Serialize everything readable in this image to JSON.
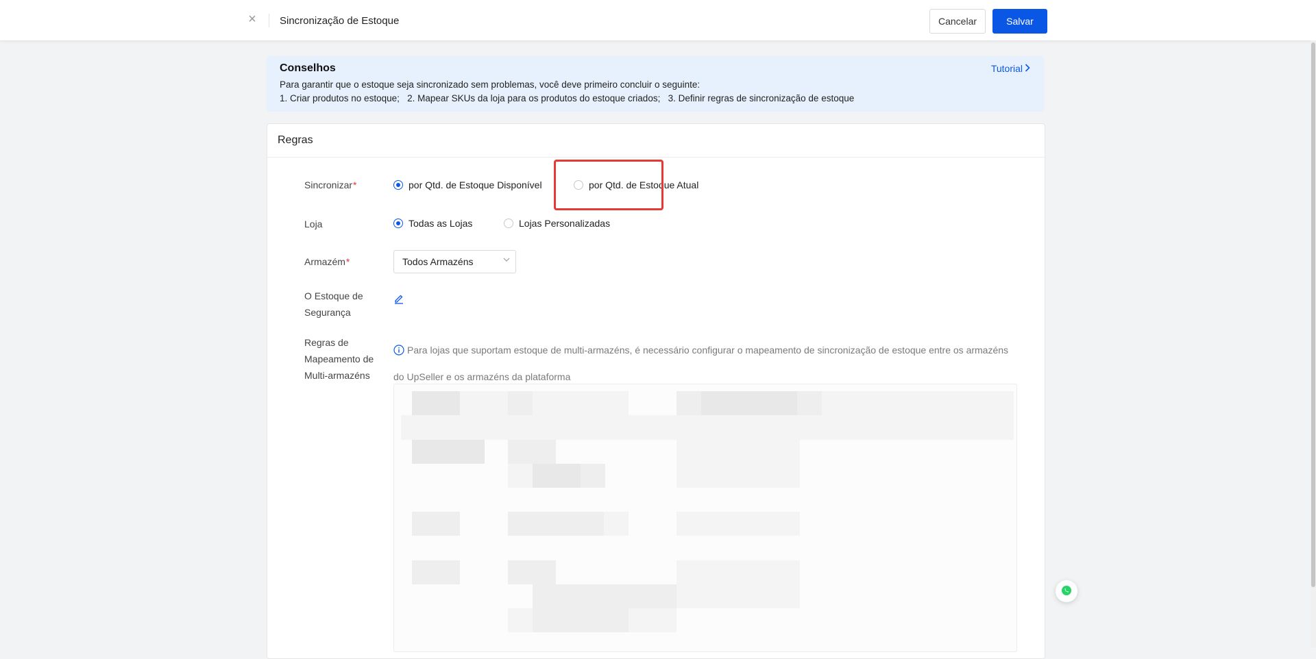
{
  "header": {
    "title": "Sincronização de Estoque",
    "close_glyph": "×",
    "cancel_label": "Cancelar",
    "save_label": "Salvar"
  },
  "tips": {
    "title": "Conselhos",
    "tutorial_label": "Tutorial",
    "line1": "Para garantir que o estoque seja sincronizado sem problemas, você deve primeiro concluir o seguinte:",
    "line2": "1. Criar produtos no estoque;   2. Mapear SKUs da loja para os produtos do estoque criados;   3. Definir regras de sincronização de estoque"
  },
  "rules": {
    "title": "Regras",
    "sync": {
      "label": "Sincronizar",
      "required_mark": "*",
      "options": [
        "por Qtd. de Estoque Disponível",
        "por Qtd. de Estoque Atual"
      ],
      "selected": 0
    },
    "store": {
      "label": "Loja",
      "options": [
        "Todas as Lojas",
        "Lojas Personalizadas"
      ],
      "selected": 0
    },
    "warehouse": {
      "label": "Armazém",
      "required_mark": "*",
      "value": "Todos Armazéns"
    },
    "safety_stock": {
      "label_line1": "O Estoque de",
      "label_line2": "Segurança"
    },
    "mapping": {
      "label_line1": "Regras de",
      "label_line2": "Mapeamento de",
      "label_line3": "Multi-armazéns",
      "info": "Para lojas que suportam estoque de multi-armazéns, é necessário configurar o mapeamento de sincronização de estoque entre os armazéns do UpSeller e os armazéns da plataforma"
    }
  },
  "colors": {
    "primary": "#0a57e6",
    "tips_bg": "#e7f1fd",
    "highlight": "#e53935",
    "whatsapp": "#25d366"
  },
  "icons": {
    "close": "close-icon",
    "tutorial": "chevron-right-icon",
    "edit": "edit-pencil-icon",
    "info": "info-icon",
    "select": "chevron-down-icon",
    "chat": "whatsapp-icon"
  }
}
